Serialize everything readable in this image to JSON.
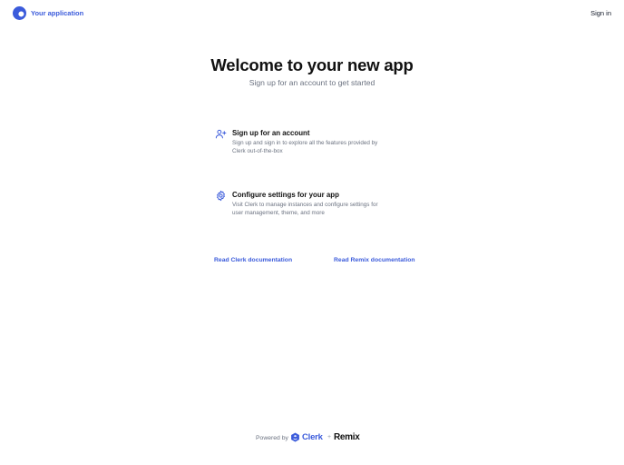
{
  "header": {
    "app_name": "Your application",
    "sign_in_label": "Sign in"
  },
  "hero": {
    "title": "Welcome to your new app",
    "subtitle": "Sign up for an account to get started"
  },
  "features": [
    {
      "icon": "user-plus-icon",
      "title": "Sign up for an account",
      "description": "Sign up and sign in to explore all the features provided by Clerk out-of-the-box"
    },
    {
      "icon": "gear-icon",
      "title": "Configure settings for your app",
      "description": "Visit Clerk to manage instances and configure settings for user management, theme, and more"
    }
  ],
  "links": {
    "clerk_docs": "Read Clerk documentation",
    "remix_docs": "Read Remix documentation"
  },
  "footer": {
    "powered_by": "Powered by",
    "clerk": "Clerk",
    "plus": "+",
    "remix": "Remix"
  },
  "colors": {
    "accent": "#3b5bdb",
    "muted_text": "#6b7280",
    "heading_text": "#111111"
  }
}
